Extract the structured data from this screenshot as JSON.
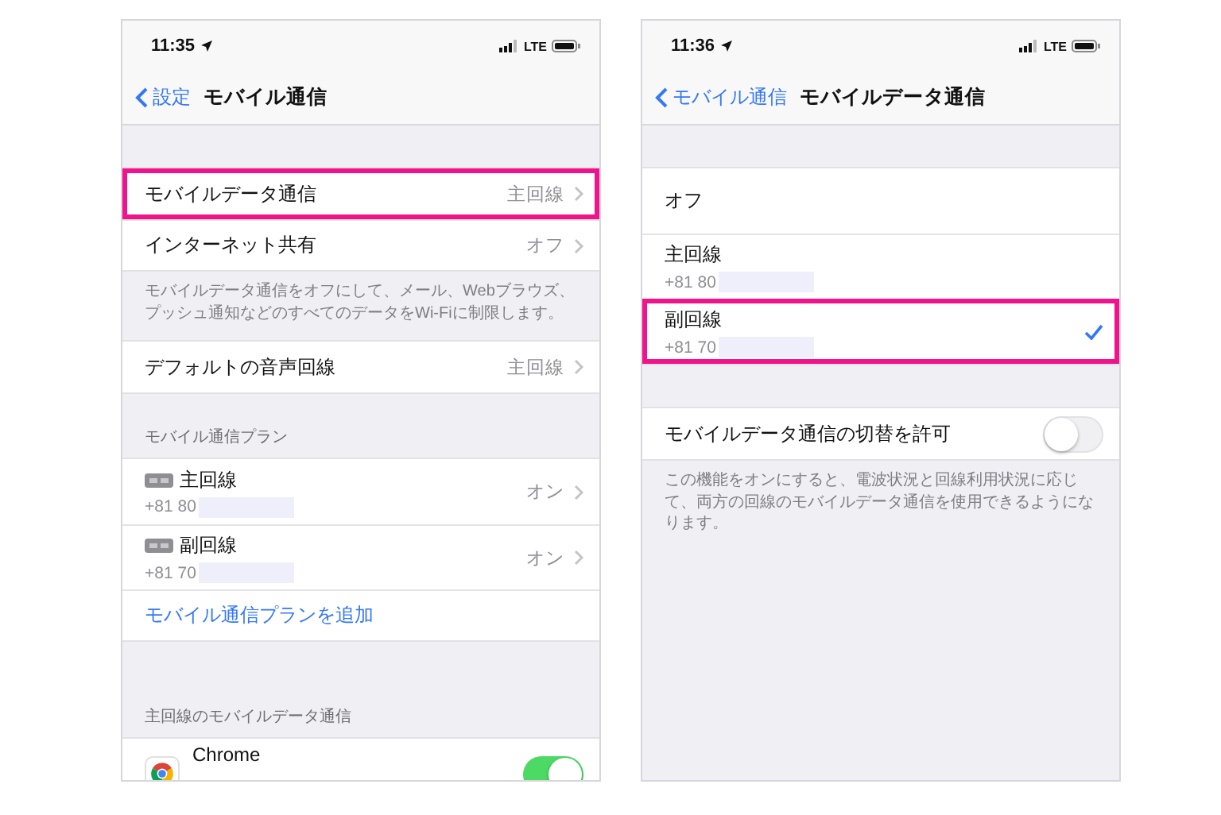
{
  "screens": [
    {
      "status_bar": {
        "time": "11:35",
        "network": "LTE"
      },
      "nav": {
        "back": "設定",
        "title": "モバイル通信"
      },
      "sections": [
        {
          "items": [
            {
              "kind": "value",
              "label": "モバイルデータ通信",
              "value": "主回線",
              "highlighted": true
            },
            {
              "kind": "value",
              "label": "インターネット共有",
              "value": "オフ",
              "highlighted": false
            }
          ],
          "footer": "モバイルデータ通信をオフにして、メール、Webブラウズ、プッシュ通知などのすべてのデータをWi-Fiに制限します。"
        },
        {
          "items": [
            {
              "kind": "value",
              "label": "デフォルトの音声回線",
              "value": "主回線",
              "highlighted": false
            }
          ]
        },
        {
          "header": "モバイル通信プラン",
          "items": [
            {
              "kind": "plan",
              "label": "主回線",
              "number": "+81 80",
              "value": "オン",
              "highlighted": false
            },
            {
              "kind": "plan",
              "label": "副回線",
              "number": "+81 70",
              "value": "オン",
              "highlighted": false
            },
            {
              "kind": "link",
              "label": "モバイル通信プランを追加",
              "highlighted": false
            }
          ]
        },
        {
          "header": "主回線のモバイルデータ通信",
          "items": [
            {
              "kind": "app",
              "label": "Chrome",
              "on": true,
              "highlighted": false
            }
          ]
        }
      ]
    },
    {
      "status_bar": {
        "time": "11:36",
        "network": "LTE"
      },
      "nav": {
        "back": "モバイル通信",
        "title": "モバイルデータ通信"
      },
      "sections": [
        {
          "items": [
            {
              "kind": "choice",
              "label": "オフ",
              "selected": false,
              "highlighted": false
            },
            {
              "kind": "choice",
              "label": "主回線",
              "number": "+81 80",
              "selected": false,
              "highlighted": false
            },
            {
              "kind": "choice",
              "label": "副回線",
              "number": "+81 70",
              "selected": true,
              "highlighted": true
            }
          ]
        },
        {
          "items": [
            {
              "kind": "toggle",
              "label": "モバイルデータ通信の切替を許可",
              "on": false,
              "highlighted": false
            }
          ],
          "footer": "この機能をオンにすると、電波状況と回線利用状況に応じて、両方の回線のモバイルデータ通信を使用できるようになります。"
        }
      ]
    }
  ]
}
